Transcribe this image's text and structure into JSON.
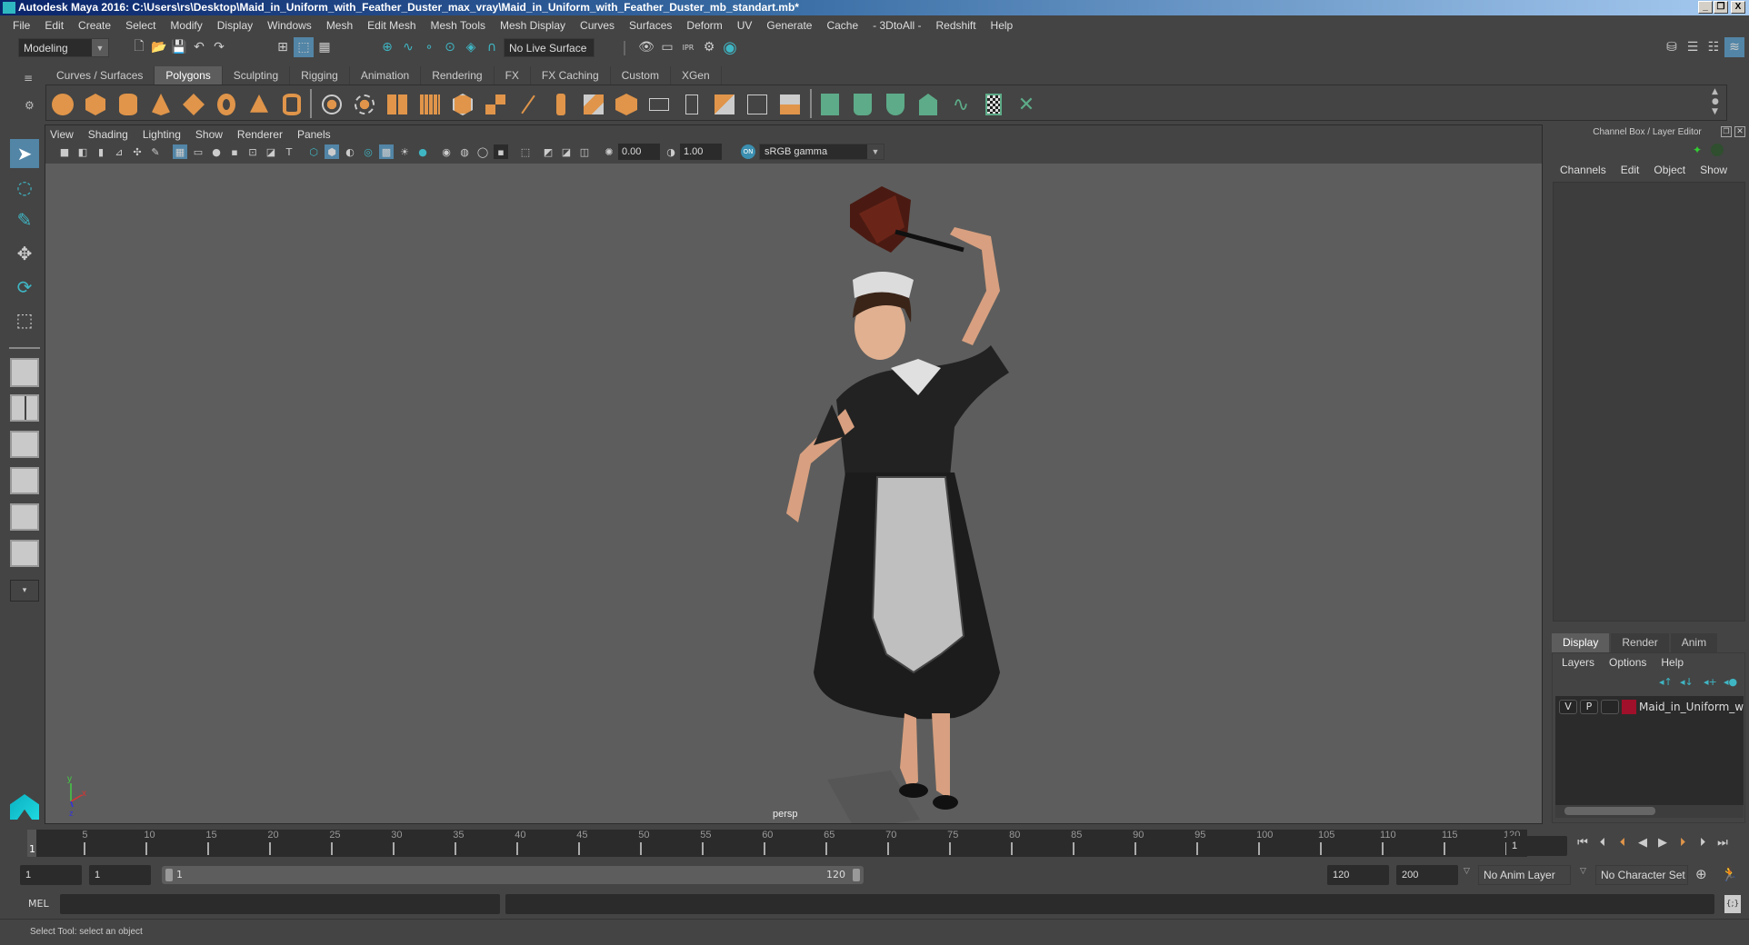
{
  "window": {
    "title": "Autodesk Maya 2016: C:\\Users\\rs\\Desktop\\Maid_in_Uniform_with_Feather_Duster_max_vray\\Maid_in_Uniform_with_Feather_Duster_mb_standart.mb*",
    "controls": {
      "minimize": "_",
      "restore": "❐",
      "close": "X"
    }
  },
  "menubar": [
    "File",
    "Edit",
    "Create",
    "Select",
    "Modify",
    "Display",
    "Windows",
    "Mesh",
    "Edit Mesh",
    "Mesh Tools",
    "Mesh Display",
    "Curves",
    "Surfaces",
    "Deform",
    "UV",
    "Generate",
    "Cache",
    "- 3DtoAll -",
    "Redshift",
    "Help"
  ],
  "statusline": {
    "mode": "Modeling",
    "live_surface": "No Live Surface",
    "file_icons": [
      "new-scene-icon",
      "open-scene-icon",
      "save-scene-icon",
      "undo-icon",
      "redo-icon"
    ],
    "select_mode_icons": [
      "hierarchy-mode-icon",
      "object-mode-icon",
      "component-mode-icon"
    ],
    "snap_icons": [
      "snap-grid-icon",
      "snap-curve-icon",
      "snap-point-icon",
      "snap-view-plane-icon",
      "snap-live-icon",
      "snap-magnet-icon"
    ],
    "render_icons": [
      "render-view-icon",
      "render-current-icon",
      "ipr-render-icon",
      "render-settings-icon",
      "hypershade-icon"
    ],
    "right_icons": [
      "modeling-toolkit-icon",
      "attribute-editor-icon",
      "tool-settings-icon",
      "channel-box-icon"
    ]
  },
  "shelf": {
    "tabs": [
      "Curves / Surfaces",
      "Polygons",
      "Sculpting",
      "Rigging",
      "Animation",
      "Rendering",
      "FX",
      "FX Caching",
      "Custom",
      "XGen"
    ],
    "active_tab": "Polygons",
    "icons": [
      "poly-sphere-icon",
      "poly-cube-icon",
      "poly-cylinder-icon",
      "poly-cone-icon",
      "poly-plane-icon",
      "poly-torus-icon",
      "poly-pyramid-icon",
      "poly-pipe-icon",
      "combine-icon",
      "separate-icon",
      "mirror-icon",
      "smooth-icon",
      "boolean-icon",
      "extract-icon",
      "bevel-icon",
      "multi-cut-icon",
      "target-weld-icon",
      "bridge-icon",
      "extrude-icon",
      "edge-loop-icon",
      "insert-edge-loop-icon",
      "split-icon",
      "fill-hole-icon",
      "append-icon",
      "uv-planar-icon",
      "uv-cylindrical-icon",
      "uv-spherical-icon",
      "uv-automatic-icon",
      "uv-unfold-icon",
      "uv-editor-icon",
      "uv-layout-icon"
    ]
  },
  "toolbox": {
    "tools": [
      "select-tool-icon",
      "lasso-tool-icon",
      "paint-select-tool-icon",
      "move-tool-icon",
      "rotate-tool-icon",
      "scale-tool-icon"
    ],
    "layouts": [
      "single-perspective-layout-icon",
      "four-view-layout-icon",
      "persp-outliner-layout-icon",
      "persp-graph-layout-icon",
      "hypershade-persp-layout-icon",
      "persp-graph-outliner-layout-icon",
      "layout-dropdown-icon"
    ]
  },
  "panel": {
    "menu": [
      "View",
      "Shading",
      "Lighting",
      "Show",
      "Renderer",
      "Panels"
    ],
    "exposure": "0.00",
    "gamma": "1.00",
    "color_space": "sRGB gamma",
    "camera_label": "persp",
    "axis": {
      "x": "x",
      "y": "y",
      "z": "z"
    }
  },
  "channel_box": {
    "title": "Channel Box / Layer Editor",
    "menu": [
      "Channels",
      "Edit",
      "Object",
      "Show"
    ]
  },
  "layer_editor": {
    "tabs": [
      "Display",
      "Render",
      "Anim"
    ],
    "active_tab": "Display",
    "menu": [
      "Layers",
      "Options",
      "Help"
    ],
    "layers": [
      {
        "visible": "V",
        "playback": "P",
        "color": "#a0102a",
        "name": "Maid_in_Uniform_with"
      }
    ]
  },
  "timeline": {
    "current_frame": "1",
    "ticks": [
      "5",
      "10",
      "15",
      "20",
      "25",
      "30",
      "35",
      "40",
      "45",
      "50",
      "55",
      "60",
      "65",
      "70",
      "75",
      "80",
      "85",
      "90",
      "95",
      "100",
      "105",
      "110",
      "115",
      "120"
    ],
    "start_marker": "1",
    "current_frame_field": "1"
  },
  "range": {
    "start": "1",
    "playback_start": "1",
    "slider_start": "1",
    "slider_end": "120",
    "playback_end": "120",
    "end": "200",
    "anim_layer": "No Anim Layer",
    "character_set": "No Character Set"
  },
  "command_line": {
    "label": "MEL",
    "input": "",
    "result": ""
  },
  "help_line": "Select Tool: select an object"
}
